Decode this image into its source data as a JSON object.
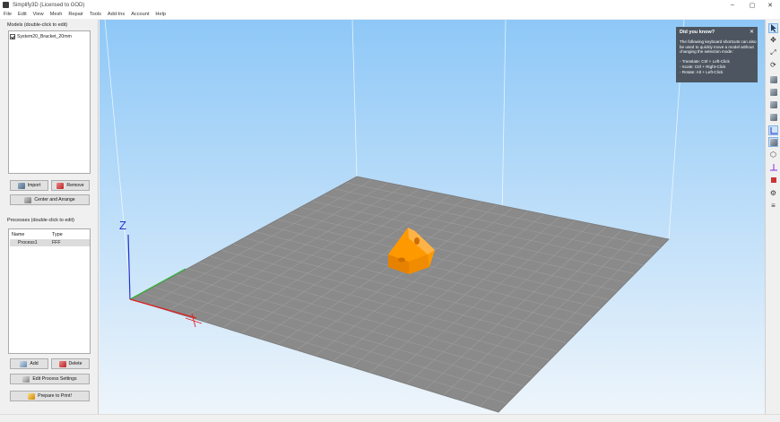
{
  "window": {
    "title": "Simplify3D (Licensed to GOD)",
    "controls": [
      "–",
      "▢",
      "✕"
    ]
  },
  "menu": [
    "File",
    "Edit",
    "View",
    "Mesh",
    "Repair",
    "Tools",
    "Add-Ins",
    "Account",
    "Help"
  ],
  "models": {
    "label": "Models (double-click to edit)",
    "items": [
      {
        "name": "System20_Bracket_20mm",
        "checked": true
      }
    ],
    "import_label": "Import",
    "remove_label": "Remove",
    "center_label": "Center and Arrange"
  },
  "processes": {
    "label": "Processes (double-click to edit)",
    "col_name": "Name",
    "col_type": "Type",
    "rows": [
      {
        "name": "Process1",
        "type": "FFF"
      }
    ],
    "add_label": "Add",
    "delete_label": "Delete",
    "edit_label": "Edit Process Settings",
    "prepare_label": "Prepare to Print!"
  },
  "viewport": {
    "z_axis_label": "Z",
    "x_axis_color": "#e02020",
    "y_axis_color": "#2fb52f",
    "z_axis_color": "#2233cc",
    "bed_color": "#8a8a8a",
    "model_color": "#ff9900"
  },
  "tip": {
    "title": "Did you know?",
    "close": "✕",
    "body": "The following keyboard shortcuts can also be used to quickly move a model without changing the selection mode:\n\n- Translate: Ctrl + Left-Click\n- Scale: Ctrl + Right-Click\n- Rotate: Alt + Left-Click"
  },
  "toolbar_icons": [
    "select-icon",
    "move-icon",
    "scale-icon",
    "rotate-icon",
    "view-default-icon",
    "view-front-icon",
    "view-side-icon",
    "view-top-icon",
    "axes-icon",
    "shaded-view-icon",
    "wireframe-icon",
    "cross-section-icon",
    "support-icon",
    "settings-icon",
    "layer-icon"
  ]
}
